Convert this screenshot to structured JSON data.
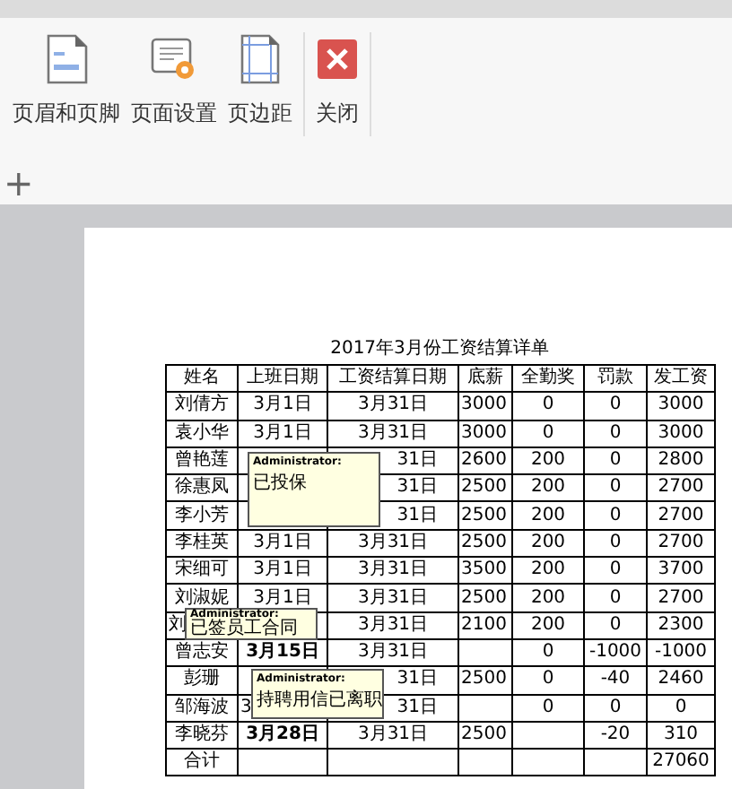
{
  "toolbar": [
    {
      "label": "页眉和页脚",
      "kind": "header-footer"
    },
    {
      "label": "页面设置",
      "kind": "page-setup"
    },
    {
      "label": "页边距",
      "kind": "margins"
    },
    {
      "label": "关闭",
      "kind": "close"
    }
  ],
  "add_sheet": "+",
  "sheet": {
    "title": "2017年3月份工资结算详单",
    "columns": [
      "姓名",
      "上班日期",
      "工资结算日期",
      "底薪",
      "全勤奖",
      "罚款",
      "发工资"
    ],
    "rows": [
      {
        "cells": [
          "刘倩方",
          "3月1日",
          "3月31日",
          "3000",
          "0",
          "0",
          "3000"
        ],
        "start_bold": false
      },
      {
        "cells": [
          "袁小华",
          "3月1日",
          "3月31日",
          "3000",
          "0",
          "0",
          "3000"
        ],
        "start_bold": false
      },
      {
        "cells": [
          "曾艳莲",
          null,
          "31日",
          "2600",
          "200",
          "0",
          "2800"
        ]
      },
      {
        "cells": [
          "徐惠凤",
          null,
          "31日",
          "2500",
          "200",
          "0",
          "2700"
        ]
      },
      {
        "cells": [
          "李小芳",
          null,
          "31日",
          "2500",
          "200",
          "0",
          "2700"
        ]
      },
      {
        "cells": [
          "李桂英",
          "3月1日",
          "3月31日",
          "2500",
          "200",
          "0",
          "2700"
        ],
        "start_bold": false
      },
      {
        "cells": [
          "宋细可",
          "3月1日",
          "3月31日",
          "3500",
          "200",
          "0",
          "3700"
        ],
        "start_bold": false
      },
      {
        "cells": [
          "刘淑妮",
          "3月1日",
          "3月31日",
          "2500",
          "200",
          "0",
          "2700"
        ],
        "start_bold": false
      },
      {
        "cells": [
          "刘",
          null,
          "3月31日",
          "2100",
          "200",
          "0",
          "2300"
        ]
      },
      {
        "cells": [
          "曾志安",
          "3月15日",
          "3月31日",
          null,
          "0",
          "-1000",
          "-1000"
        ],
        "start_bold": true
      },
      {
        "cells": [
          "彭珊",
          null,
          "31日",
          "2500",
          "0",
          "-40",
          "2460"
        ]
      },
      {
        "cells": [
          "邹海波",
          "3",
          "31日",
          null,
          "0",
          "0",
          "0"
        ],
        "start_bold": false
      },
      {
        "cells": [
          "李晓芬",
          "3月28日",
          "3月31日",
          "2500",
          null,
          "-20",
          "310"
        ],
        "start_bold": true
      },
      {
        "cells": [
          "合计",
          null,
          null,
          null,
          null,
          null,
          "27060"
        ]
      }
    ],
    "comments": [
      {
        "author": "Administrator:",
        "text": "已投保"
      },
      {
        "author": "Administrator:",
        "text": "已签员工合同"
      },
      {
        "author": "Administrator:",
        "text": "持聘用信已离职"
      }
    ]
  }
}
